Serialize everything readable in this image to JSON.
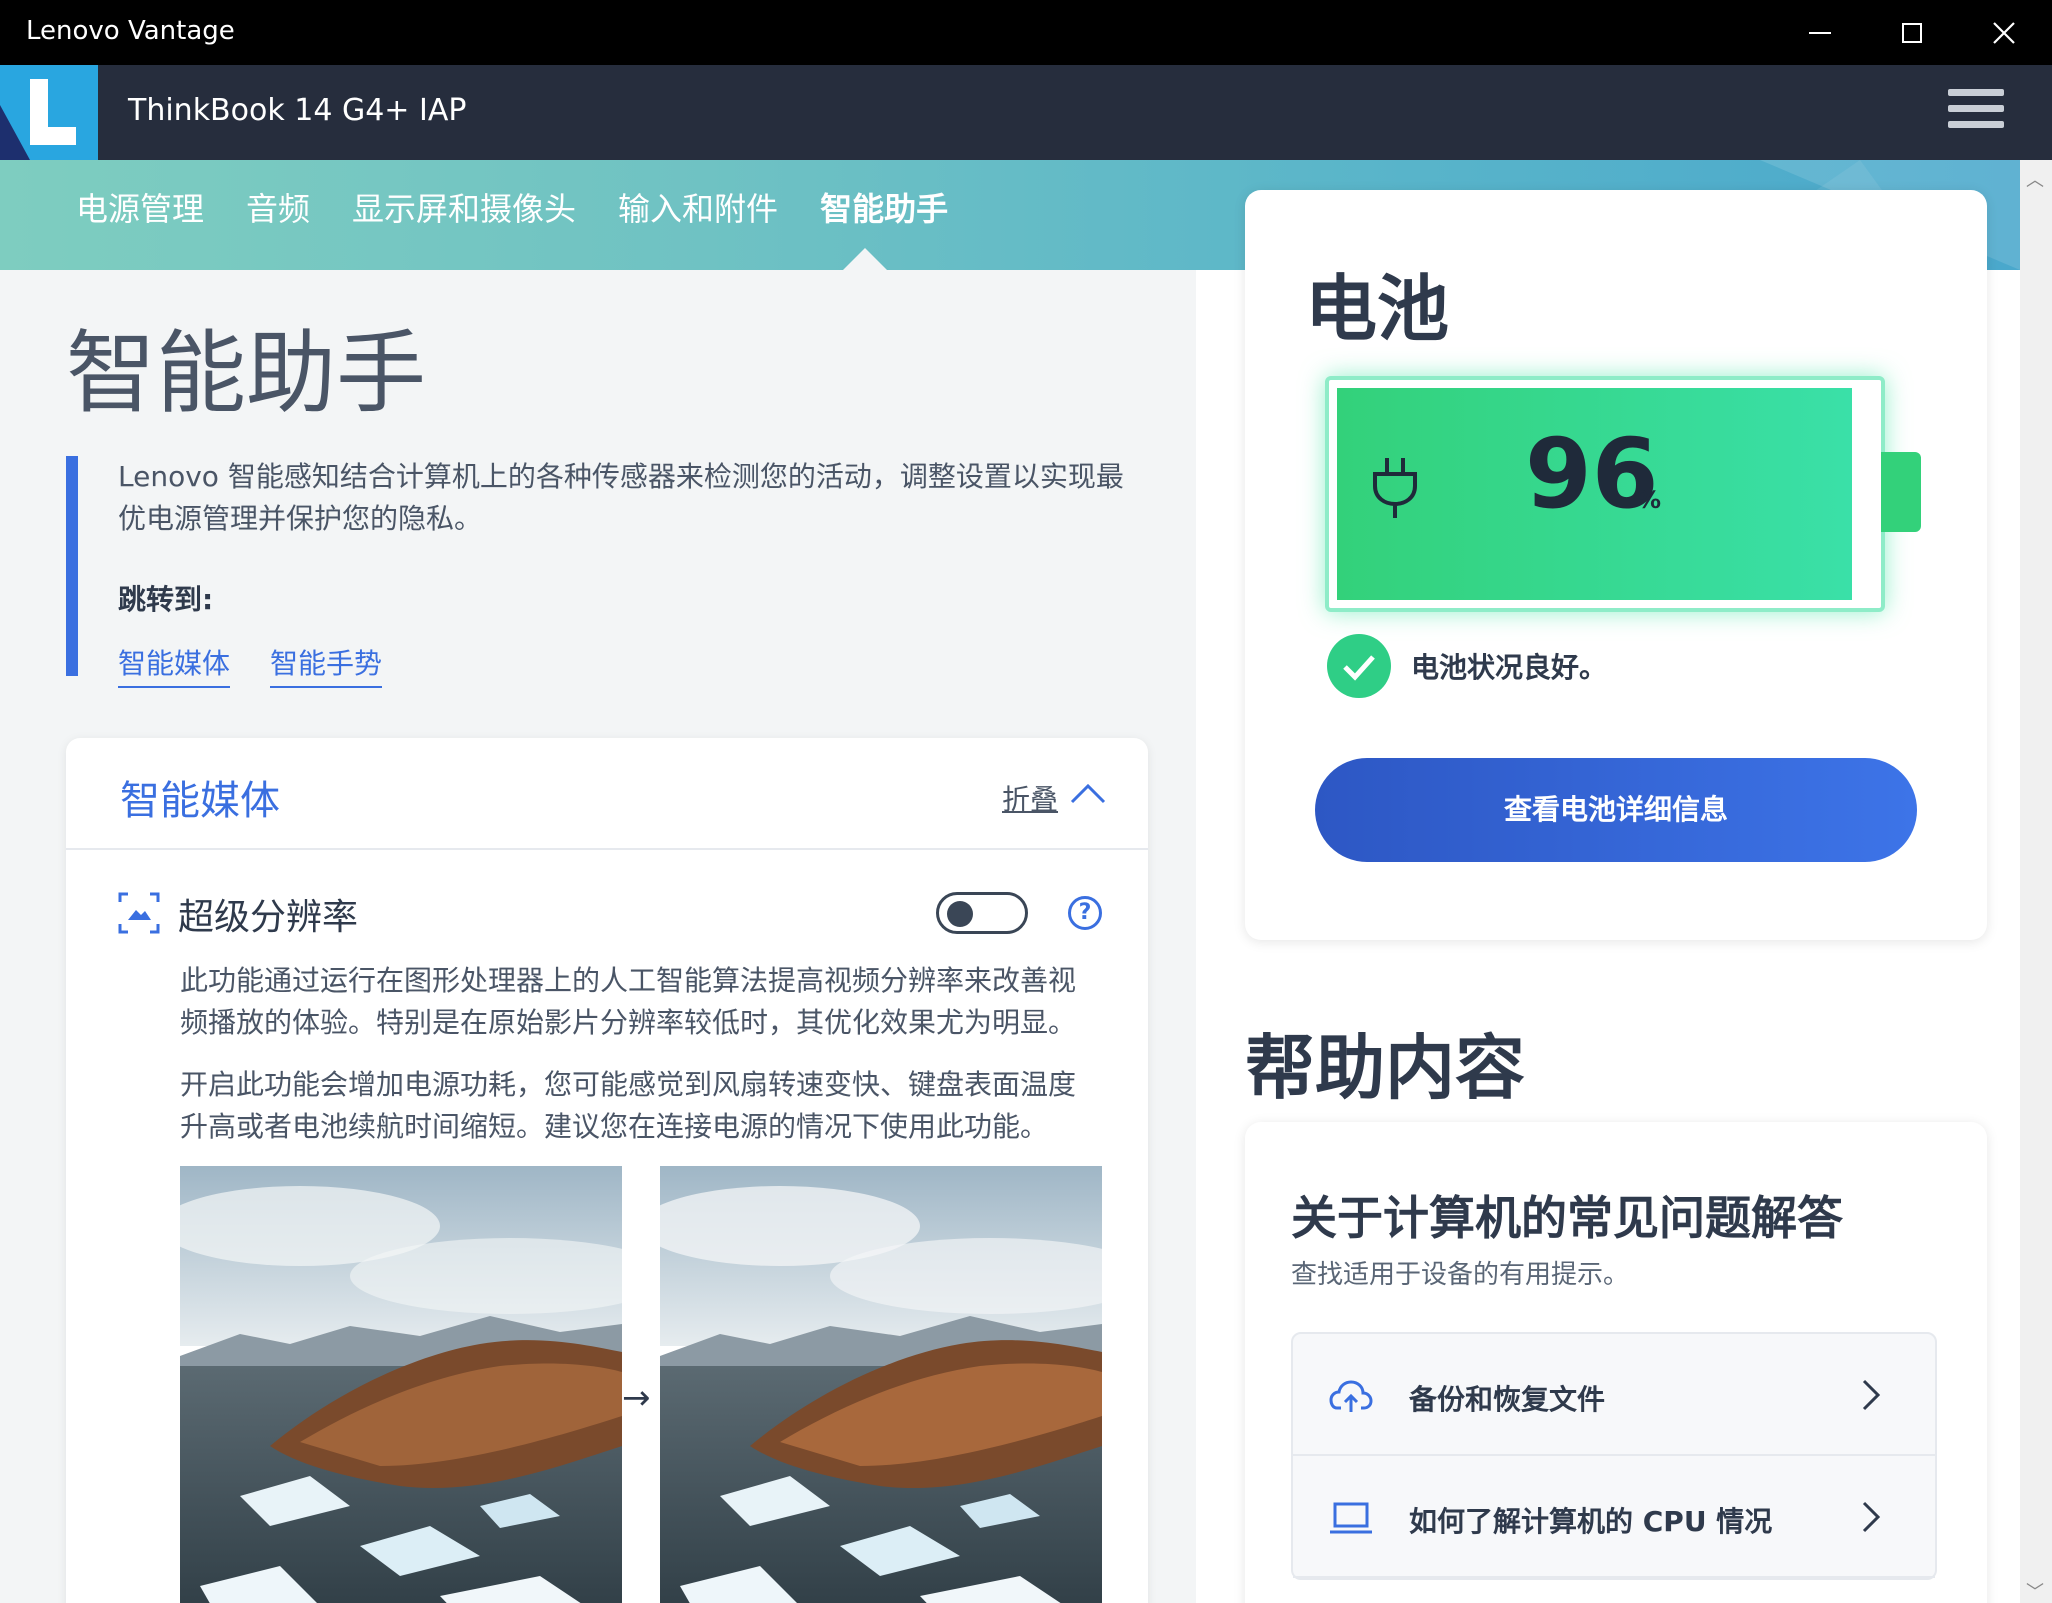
{
  "window": {
    "title": "Lenovo Vantage"
  },
  "header": {
    "model": "ThinkBook 14 G4+ IAP"
  },
  "nav": {
    "tabs": [
      {
        "label": "电源管理"
      },
      {
        "label": "音频"
      },
      {
        "label": "显示屏和摄像头"
      },
      {
        "label": "输入和附件"
      },
      {
        "label": "智能助手",
        "active": true
      }
    ]
  },
  "page": {
    "title": "智能助手",
    "intro": "Lenovo 智能感知结合计算机上的各种传感器来检测您的活动，调整设置以实现最优电源管理并保护您的隐私。",
    "jump_label": "跳转到:",
    "jump_links": [
      "智能媒体",
      "智能手势"
    ]
  },
  "media_card": {
    "title": "智能媒体",
    "collapse_label": "折叠",
    "feature": {
      "title": "超级分辨率",
      "toggle_on": false,
      "desc1": "此功能通过运行在图形处理器上的人工智能算法提高视频分辨率来改善视频播放的体验。特别是在原始影片分辨率较低时，其优化效果尤为明显。",
      "desc2": "开启此功能会增加电源功耗，您可能感觉到风扇转速变快、键盘表面温度升高或者电池续航时间缩短。建议您在连接电源的情况下使用此功能。"
    }
  },
  "battery": {
    "title": "电池",
    "percent": "96",
    "percent_unit": "%",
    "level": 0.96,
    "status": "电池状况良好。",
    "details_button": "查看电池详细信息"
  },
  "help": {
    "title": "帮助内容",
    "faq_title": "关于计算机的常见问题解答",
    "faq_sub": "查找适用于设备的有用提示。",
    "items": [
      {
        "label": "备份和恢复文件",
        "icon": "cloud-upload-icon"
      },
      {
        "label": "如何了解计算机的 CPU 情况",
        "icon": "laptop-icon"
      }
    ]
  },
  "colors": {
    "accent": "#3a6fe0",
    "battery": "#33d17a",
    "header": "#262d3d"
  }
}
